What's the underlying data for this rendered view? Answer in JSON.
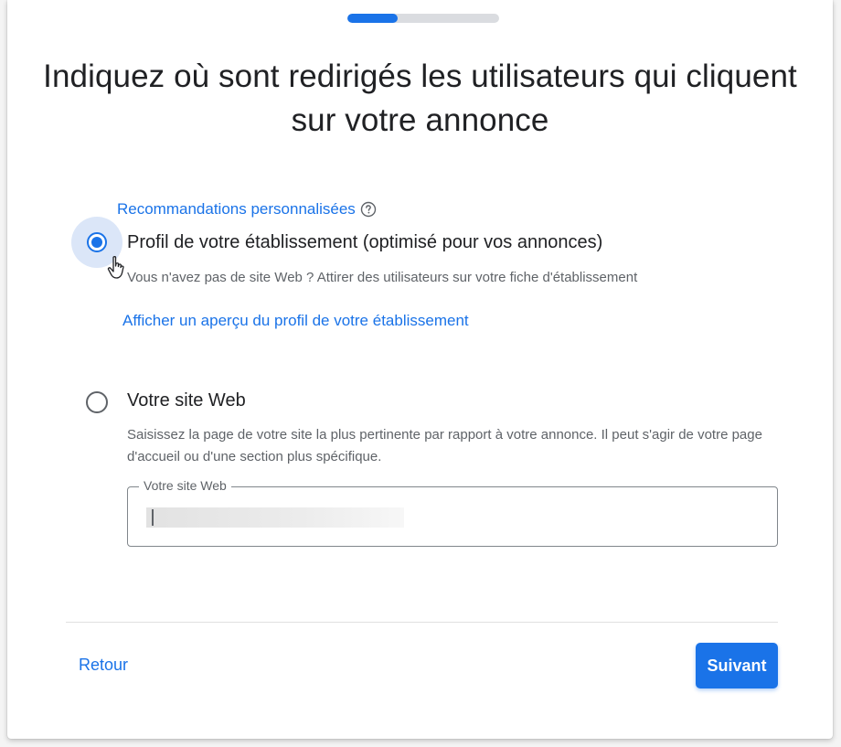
{
  "progress": {
    "value": 0.33
  },
  "heading": "Indiquez où sont redirigés les utilisateurs qui cliquent sur votre annonce",
  "recommendation": {
    "label": "Recommandations personnalisées",
    "icon": "help-circle-icon"
  },
  "options": [
    {
      "label": "Profil de votre établissement (optimisé pour vos annonces)",
      "description": "Vous n'avez pas de site Web ? Attirer des utilisateurs sur votre fiche d'établissement",
      "link": "Afficher un aperçu du profil de votre établissement",
      "selected": true
    },
    {
      "label": "Votre site Web",
      "description": "Saisissez la page de votre site la plus pertinente par rapport à votre annonce. Il peut s'agir de votre page d'accueil ou d'une section plus spécifique.",
      "selected": false
    }
  ],
  "website_field": {
    "label": "Votre site Web",
    "value": ""
  },
  "footer": {
    "back_label": "Retour",
    "next_label": "Suivant"
  },
  "colors": {
    "accent": "#1a73e8",
    "progress_track": "#dadce0",
    "text": "#202124",
    "secondary_text": "#5f6368"
  }
}
